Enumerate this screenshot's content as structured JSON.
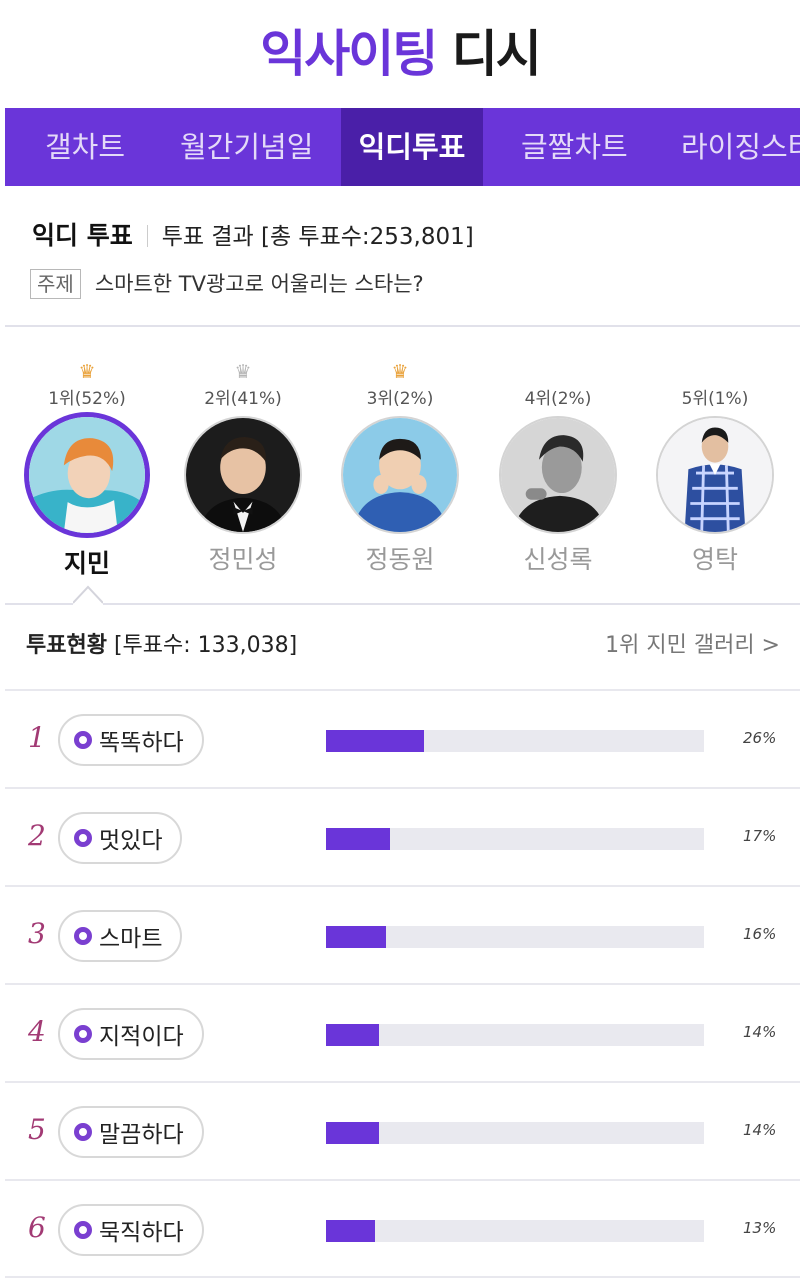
{
  "logo": {
    "part1": "익사이팅",
    "part2": " 디시"
  },
  "tabs": [
    {
      "label": "갤차트",
      "active": false
    },
    {
      "label": "월간기념일",
      "active": false
    },
    {
      "label": "익디투표",
      "active": true
    },
    {
      "label": "글짤차트",
      "active": false
    },
    {
      "label": "라이징스타",
      "active": false
    }
  ],
  "vote": {
    "title": "익디 투표",
    "result_text": "투표 결과 [총 투표수:253,801]",
    "topic_tag": "주제",
    "topic": "스마트한 TV광고로 어울리는 스타는?"
  },
  "candidates": [
    {
      "rank": "1위(52%)",
      "name": "지민",
      "crown": "gold",
      "selected": true
    },
    {
      "rank": "2위(41%)",
      "name": "정민성",
      "crown": "silver",
      "selected": false
    },
    {
      "rank": "3위(2%)",
      "name": "정동원",
      "crown": "gold",
      "selected": false
    },
    {
      "rank": "4위(2%)",
      "name": "신성록",
      "crown": "none",
      "selected": false
    },
    {
      "rank": "5위(1%)",
      "name": "영탁",
      "crown": "none",
      "selected": false
    }
  ],
  "status": {
    "label": "투표현황",
    "count": " [투표수: 133,038]",
    "gallery_link": "1위 지민 갤러리 >"
  },
  "keywords": [
    {
      "rank": "1",
      "label": "똑똑하다",
      "percent_text": "26%",
      "percent": 26
    },
    {
      "rank": "2",
      "label": "멋있다",
      "percent_text": "17%",
      "percent": 17
    },
    {
      "rank": "3",
      "label": "스마트",
      "percent_text": "16%",
      "percent": 16
    },
    {
      "rank": "4",
      "label": "지적이다",
      "percent_text": "14%",
      "percent": 14
    },
    {
      "rank": "5",
      "label": "말끔하다",
      "percent_text": "14%",
      "percent": 14
    },
    {
      "rank": "6",
      "label": "묵직하다",
      "percent_text": "13%",
      "percent": 13
    }
  ],
  "colors": {
    "accent": "#6a35d9",
    "accent_dark": "#4a1fa8",
    "rank_number": "#a23a74",
    "crown_gold": "#e9a23b",
    "crown_silver": "#b5b5b5"
  },
  "icons": {
    "crown": "crown-icon",
    "keyword": "ring-icon",
    "chevron": "chevron-right-icon"
  }
}
